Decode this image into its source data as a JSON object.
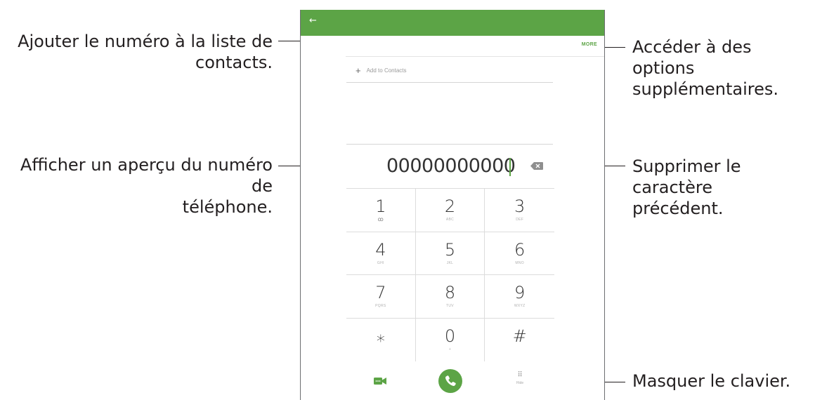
{
  "callouts": {
    "add_contacts": {
      "line1": "Ajouter le numéro à la liste de",
      "line2": "contacts."
    },
    "preview": {
      "line1": "Afficher un aperçu du numéro de",
      "line2": "téléphone."
    },
    "more_options": {
      "line1": "Accéder à des options",
      "line2": "supplémentaires."
    },
    "backspace": {
      "line1": "Supprimer le caractère",
      "line2": "précédent."
    },
    "hide_keypad": {
      "line1": "Masquer le clavier."
    }
  },
  "screen": {
    "back_glyph": "←",
    "more_label": "MORE",
    "add_to_contacts": "Add to Contacts",
    "add_plus": "+",
    "number": "00000000000",
    "keys": [
      {
        "digit": "1",
        "sub": "ꝏ"
      },
      {
        "digit": "2",
        "sub": "ABC"
      },
      {
        "digit": "3",
        "sub": "DEF"
      },
      {
        "digit": "4",
        "sub": "GHI"
      },
      {
        "digit": "5",
        "sub": "JKL"
      },
      {
        "digit": "6",
        "sub": "MNO"
      },
      {
        "digit": "7",
        "sub": "PQRS"
      },
      {
        "digit": "8",
        "sub": "TUV"
      },
      {
        "digit": "9",
        "sub": "WXYZ"
      },
      {
        "digit": "⁎",
        "sub": ""
      },
      {
        "digit": "0",
        "sub": "+"
      },
      {
        "digit": "#",
        "sub": ""
      }
    ],
    "hide_label": "Hide",
    "hide_glyph": "⠿"
  },
  "colors": {
    "accent": "#5ca446",
    "text": "#231f20"
  }
}
